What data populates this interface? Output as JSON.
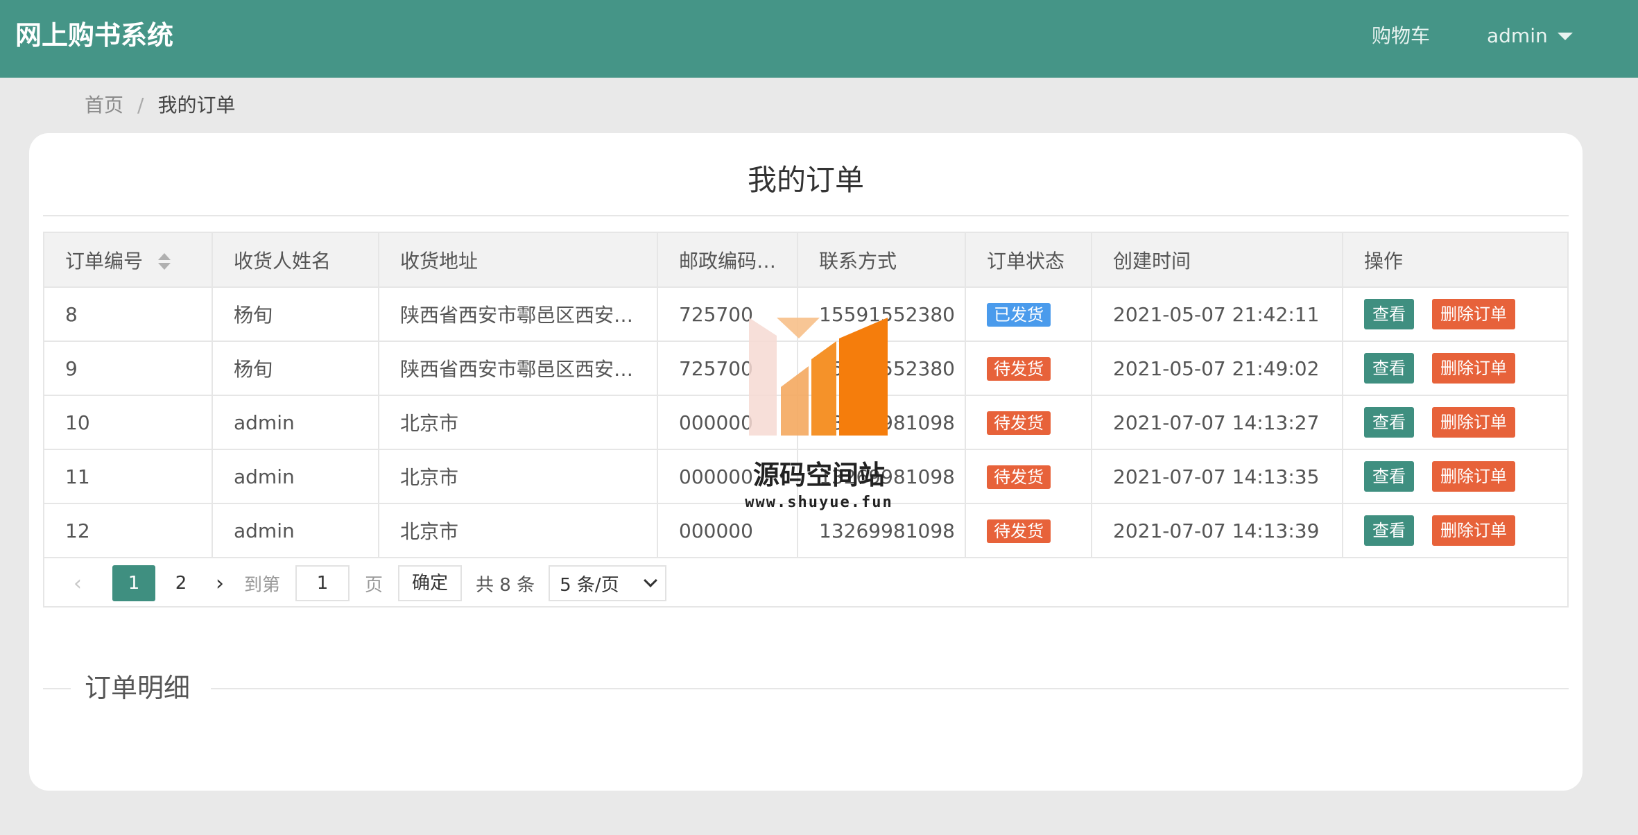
{
  "header": {
    "brand": "网上购书系统",
    "cart_label": "购物车",
    "user_label": "admin"
  },
  "breadcrumb": {
    "home": "首页",
    "separator": "/",
    "current": "我的订单"
  },
  "main": {
    "title": "我的订单"
  },
  "table": {
    "headers": [
      "订单编号",
      "收货人姓名",
      "收货地址",
      "邮政编码…",
      "联系方式",
      "订单状态",
      "创建时间",
      "操作"
    ],
    "rows": [
      {
        "id": "8",
        "name": "杨旬",
        "address": "陕西省西安市鄠邑区西安…",
        "zip": "725700",
        "phone": "15591552380",
        "status": "已发货",
        "status_color": "#4a9bec",
        "created": "2021-05-07 21:42:11"
      },
      {
        "id": "9",
        "name": "杨旬",
        "address": "陕西省西安市鄠邑区西安…",
        "zip": "725700",
        "phone": "15591552380",
        "status": "待发货",
        "status_color": "#e7623a",
        "created": "2021-05-07 21:49:02"
      },
      {
        "id": "10",
        "name": "admin",
        "address": "北京市",
        "zip": "000000",
        "phone": "13269981098",
        "status": "待发货",
        "status_color": "#e7623a",
        "created": "2021-07-07 14:13:27"
      },
      {
        "id": "11",
        "name": "admin",
        "address": "北京市",
        "zip": "000000",
        "phone": "13269981098",
        "status": "待发货",
        "status_color": "#e7623a",
        "created": "2021-07-07 14:13:35"
      },
      {
        "id": "12",
        "name": "admin",
        "address": "北京市",
        "zip": "000000",
        "phone": "13269981098",
        "status": "待发货",
        "status_color": "#e7623a",
        "created": "2021-07-07 14:13:39"
      }
    ],
    "actions": {
      "view": "查看",
      "delete": "删除订单"
    }
  },
  "pagination": {
    "prev_icon": "chevron-left-icon",
    "pages": [
      "1",
      "2"
    ],
    "current_page": "1",
    "next_icon": "chevron-right-icon",
    "goto_label": "到第",
    "goto_value": "1",
    "page_label": "页",
    "confirm_label": "确定",
    "total_label": "共 8 条",
    "page_size": "5 条/页"
  },
  "detail": {
    "title": "订单明细"
  },
  "watermark": {
    "name": "源码空间站",
    "url": "www.shuyue.fun"
  },
  "colors": {
    "primary": "#459587",
    "button_green": "#3f8f80",
    "danger": "#e7623a",
    "info": "#4a9bec"
  }
}
